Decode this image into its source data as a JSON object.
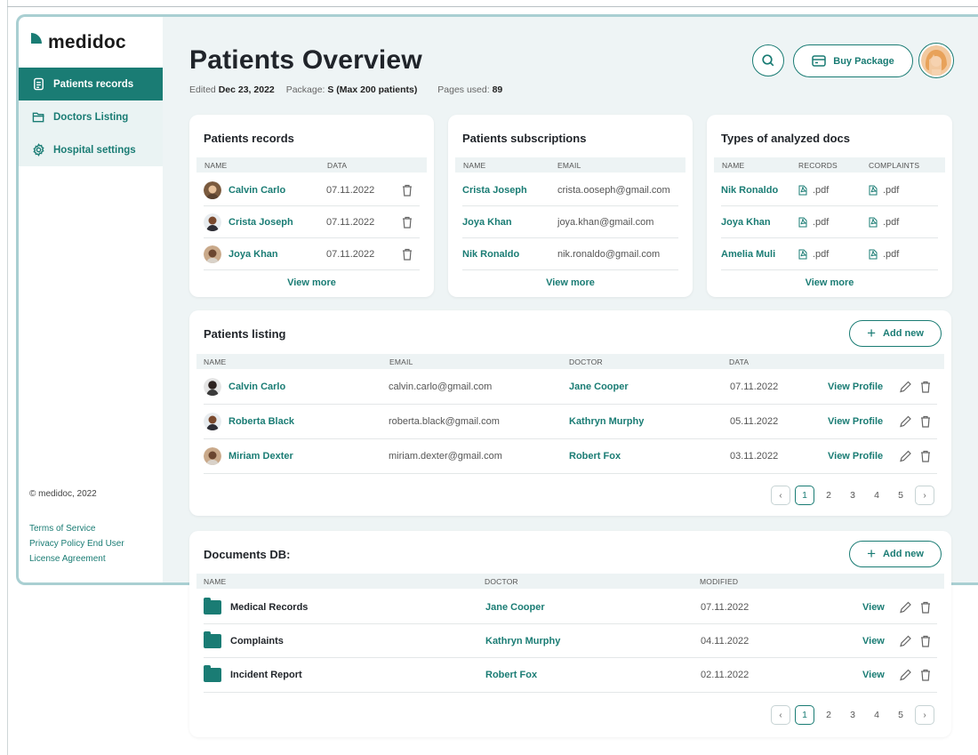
{
  "brand": {
    "name": "medidoc"
  },
  "sidebar": {
    "items": [
      {
        "label": "Patients records"
      },
      {
        "label": "Doctors Listing"
      },
      {
        "label": "Hospital settings"
      }
    ],
    "copyright": "© medidoc, 2022",
    "links": [
      "Terms of Service",
      "Privacy Policy End User",
      "License Agreement"
    ]
  },
  "header": {
    "title": "Patients Overview",
    "edited_label": "Edited",
    "edited_value": "Dec 23, 2022",
    "package_label": "Package:",
    "package_value": "S (Max 200 patients)",
    "pages_label": "Pages used:",
    "pages_value": "89",
    "buy_label": "Buy Package"
  },
  "records_card": {
    "title": "Patients records",
    "columns": [
      "NAME",
      "DATA"
    ],
    "rows": [
      {
        "name": "Calvin Carlo",
        "date": "07.11.2022"
      },
      {
        "name": "Crista Joseph",
        "date": "07.11.2022"
      },
      {
        "name": "Joya Khan",
        "date": "07.11.2022"
      }
    ],
    "view_more": "View more"
  },
  "subs_card": {
    "title": "Patients subscriptions",
    "columns": [
      "NAME",
      "EMAIL"
    ],
    "rows": [
      {
        "name": "Crista Joseph",
        "email": "crista.ooseph@gmail.com"
      },
      {
        "name": "Joya Khan",
        "email": "joya.khan@gmail.com"
      },
      {
        "name": "Nik Ronaldo",
        "email": "nik.ronaldo@gmail.com"
      }
    ],
    "view_more": "View more"
  },
  "docs_card": {
    "title": "Types of analyzed docs",
    "columns": [
      "NAME",
      "RECORDS",
      "COMPLAINTS"
    ],
    "rows": [
      {
        "name": "Nik Ronaldo",
        "records": ".pdf",
        "complaints": ".pdf"
      },
      {
        "name": "Joya Khan",
        "records": ".pdf",
        "complaints": ".pdf"
      },
      {
        "name": "Amelia Muli",
        "records": ".pdf",
        "complaints": ".pdf"
      }
    ],
    "view_more": "View more"
  },
  "listing": {
    "title": "Patients listing",
    "add_label": "Add new",
    "columns": [
      "NAME",
      "EMAIL",
      "DOCTOR",
      "DATA"
    ],
    "rows": [
      {
        "name": "Calvin Carlo",
        "email": "calvin.carlo@gmail.com",
        "doctor": "Jane Cooper",
        "date": "07.11.2022",
        "action": "View Profile"
      },
      {
        "name": "Roberta Black",
        "email": "roberta.black@gmail.com",
        "doctor": "Kathryn Murphy",
        "date": "05.11.2022",
        "action": "View Profile"
      },
      {
        "name": "Miriam Dexter",
        "email": "miriam.dexter@gmail.com",
        "doctor": "Robert Fox",
        "date": "03.11.2022",
        "action": "View Profile"
      }
    ],
    "pages": [
      "1",
      "2",
      "3",
      "4",
      "5"
    ]
  },
  "documents": {
    "title": "Documents DB:",
    "add_label": "Add new",
    "columns": [
      "NAME",
      "DOCTOR",
      "MODIFIED"
    ],
    "rows": [
      {
        "name": "Medical Records",
        "doctor": "Jane Cooper",
        "modified": "07.11.2022",
        "action": "View"
      },
      {
        "name": "Complaints",
        "doctor": "Kathryn Murphy",
        "modified": "04.11.2022",
        "action": "View"
      },
      {
        "name": "Incident Report",
        "doctor": "Robert Fox",
        "modified": "02.11.2022",
        "action": "View"
      }
    ],
    "pages": [
      "1",
      "2",
      "3",
      "4",
      "5"
    ]
  },
  "colors": {
    "accent": "#1a7c74",
    "frame": "#a9cfd2",
    "background": "#eef4f5"
  }
}
